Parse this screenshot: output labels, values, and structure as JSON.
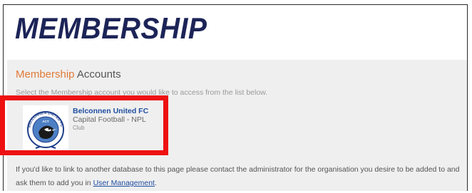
{
  "header": {
    "title": "MEMBERSHIP"
  },
  "section": {
    "heading_accent": "Membership",
    "heading_rest": "Accounts",
    "instruction": "Select the Membership account you would like to access from the list below."
  },
  "accounts": [
    {
      "name": "Belconnen United FC",
      "association": "Capital Football - NPL",
      "type": "Club",
      "logo_text_top": "BELCONNEN UNITED FC",
      "logo_text_mid": "ACT",
      "logo_icon": "magpie-crest-icon"
    }
  ],
  "footer": {
    "text_before_link": "If you'd like to link to another database to this page please contact the administrator for the organisation you desire to be added to and ask them to add you in ",
    "link_label": "User Management",
    "text_after_link": "."
  },
  "colors": {
    "title": "#1c2457",
    "accent": "#e07a38",
    "link": "#1f4ea1",
    "highlight": "#ee1111",
    "panel_bg": "#efefef"
  }
}
